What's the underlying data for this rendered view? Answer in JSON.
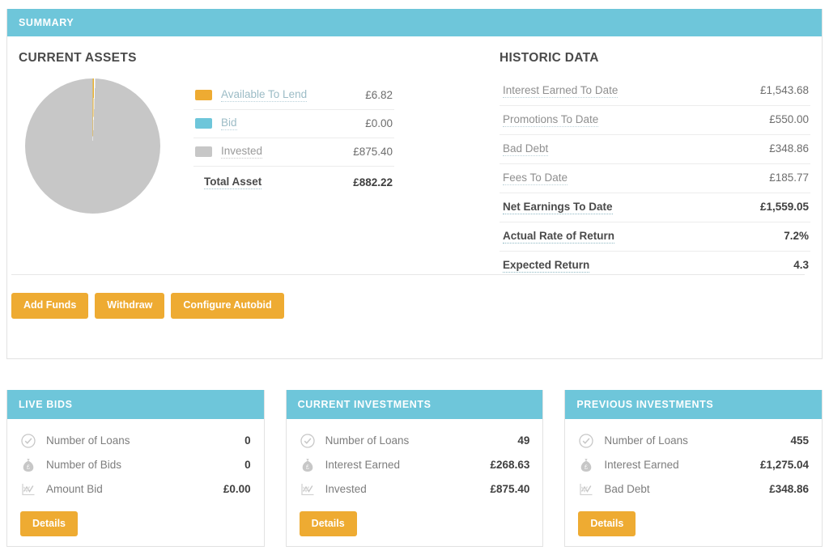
{
  "summary": {
    "header": "SUMMARY",
    "current_assets": {
      "title": "CURRENT ASSETS",
      "legend": [
        {
          "label": "Available To Lend",
          "value": "£6.82",
          "color": "#eeab32",
          "dim": false
        },
        {
          "label": "Bid",
          "value": "£0.00",
          "color": "#6ec6da",
          "dim": false
        },
        {
          "label": "Invested",
          "value": "£875.40",
          "color": "#c7c7c7",
          "dim": true
        }
      ],
      "total_label": "Total Asset",
      "total_value": "£882.22"
    },
    "historic_data": {
      "title": "HISTORIC DATA",
      "rows": [
        {
          "label": "Interest Earned To Date",
          "value": "£1,543.68",
          "strong": false
        },
        {
          "label": "Promotions To Date",
          "value": "£550.00",
          "strong": false
        },
        {
          "label": "Bad Debt",
          "value": "£348.86",
          "strong": false
        },
        {
          "label": "Fees To Date",
          "value": "£185.77",
          "strong": false
        },
        {
          "label": "Net Earnings To Date",
          "value": "£1,559.05",
          "strong": true
        },
        {
          "label": "Actual Rate of Return",
          "value": "7.2%",
          "strong": true
        },
        {
          "label": "Expected Return",
          "value": "4.3",
          "strong": true
        }
      ]
    },
    "actions": [
      {
        "label": "Add Funds"
      },
      {
        "label": "Withdraw"
      },
      {
        "label": "Configure Autobid"
      }
    ]
  },
  "cards": [
    {
      "header": "LIVE BIDS",
      "rows": [
        {
          "icon": "check-circle-icon",
          "label": "Number of Loans",
          "value": "0"
        },
        {
          "icon": "money-bag-icon",
          "label": "Number of Bids",
          "value": "0"
        },
        {
          "icon": "line-chart-icon",
          "label": "Amount Bid",
          "value": "£0.00"
        }
      ],
      "details_label": "Details"
    },
    {
      "header": "CURRENT INVESTMENTS",
      "rows": [
        {
          "icon": "check-circle-icon",
          "label": "Number of Loans",
          "value": "49"
        },
        {
          "icon": "money-bag-icon",
          "label": "Interest Earned",
          "value": "£268.63"
        },
        {
          "icon": "line-chart-icon",
          "label": "Invested",
          "value": "£875.40"
        }
      ],
      "details_label": "Details"
    },
    {
      "header": "PREVIOUS INVESTMENTS",
      "rows": [
        {
          "icon": "check-circle-icon",
          "label": "Number of Loans",
          "value": "455"
        },
        {
          "icon": "money-bag-icon",
          "label": "Interest Earned",
          "value": "£1,275.04"
        },
        {
          "icon": "line-chart-icon",
          "label": "Bad Debt",
          "value": "£348.86"
        }
      ],
      "details_label": "Details"
    }
  ],
  "chart_data": {
    "type": "pie",
    "title": "CURRENT ASSETS",
    "labels": [
      "Available To Lend",
      "Bid",
      "Invested"
    ],
    "values": [
      6.82,
      0.0,
      875.4
    ],
    "colors": [
      "#eeab32",
      "#6ec6da",
      "#c7c7c7"
    ],
    "total": 882.22,
    "currency": "£",
    "legend_position": "right"
  },
  "theme": {
    "header_bg": "#6ec6da",
    "button_bg": "#eeab32",
    "grey_slice": "#c7c7c7"
  }
}
